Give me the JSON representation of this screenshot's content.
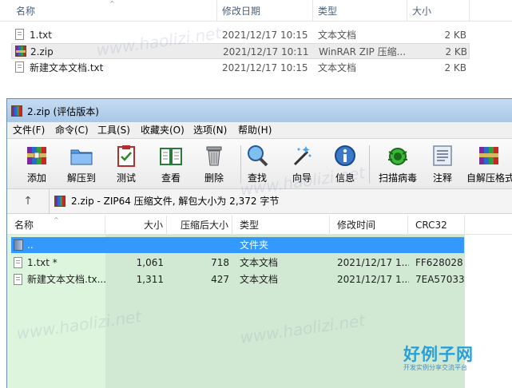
{
  "explorer": {
    "columns": {
      "name": "名称",
      "date": "修改日期",
      "type": "类型",
      "size": "大小"
    },
    "files": [
      {
        "name": "1.txt",
        "date": "2021/12/17 10:15",
        "type": "文本文档",
        "size": "2 KB",
        "icon": "txt-file-icon"
      },
      {
        "name": "2.zip",
        "date": "2021/12/17 10:11",
        "type": "WinRAR ZIP 压缩...",
        "size": "2 KB",
        "icon": "winrar-archive-icon"
      },
      {
        "name": "新建文本文档.txt",
        "date": "2021/12/17 10:15",
        "type": "文本文档",
        "size": "2 KB",
        "icon": "txt-file-icon"
      }
    ]
  },
  "winrar": {
    "title": "2.zip (评估版本)",
    "menu": [
      "文件(F)",
      "命令(C)",
      "工具(S)",
      "收藏夹(O)",
      "选项(N)",
      "帮助(H)"
    ],
    "toolbar": [
      "添加",
      "解压到",
      "测试",
      "查看",
      "删除",
      "查找",
      "向导",
      "信息",
      "扫描病毒",
      "注释",
      "自解压格式"
    ],
    "path": "2.zip - ZIP64 压缩文件, 解包大小为 2,372 字节",
    "columns": {
      "name": "名称",
      "size": "大小",
      "packed": "压缩后大小",
      "type": "类型",
      "modified": "修改时间",
      "crc": "CRC32"
    },
    "rows": [
      {
        "name": "..",
        "size": "",
        "packed": "",
        "type": "文件夹",
        "modified": "",
        "crc": ""
      },
      {
        "name": "1.txt *",
        "size": "1,061",
        "packed": "718",
        "type": "文本文档",
        "modified": "2021/12/17 1...",
        "crc": "FF628028"
      },
      {
        "name": "新建文本文档.tx...",
        "size": "1,311",
        "packed": "427",
        "type": "文本文档",
        "modified": "2021/12/17 1...",
        "crc": "7EA57033"
      }
    ]
  },
  "watermark": {
    "site": "www.haolizi.net",
    "brand": "好例子网",
    "slogan": "开发实例分享交流平台"
  },
  "colors": {
    "selection": "#3399ff",
    "list_green_left": "#ddf5dd",
    "list_green_right": "#d1e9d3",
    "titlebar": "#b4cfec"
  }
}
